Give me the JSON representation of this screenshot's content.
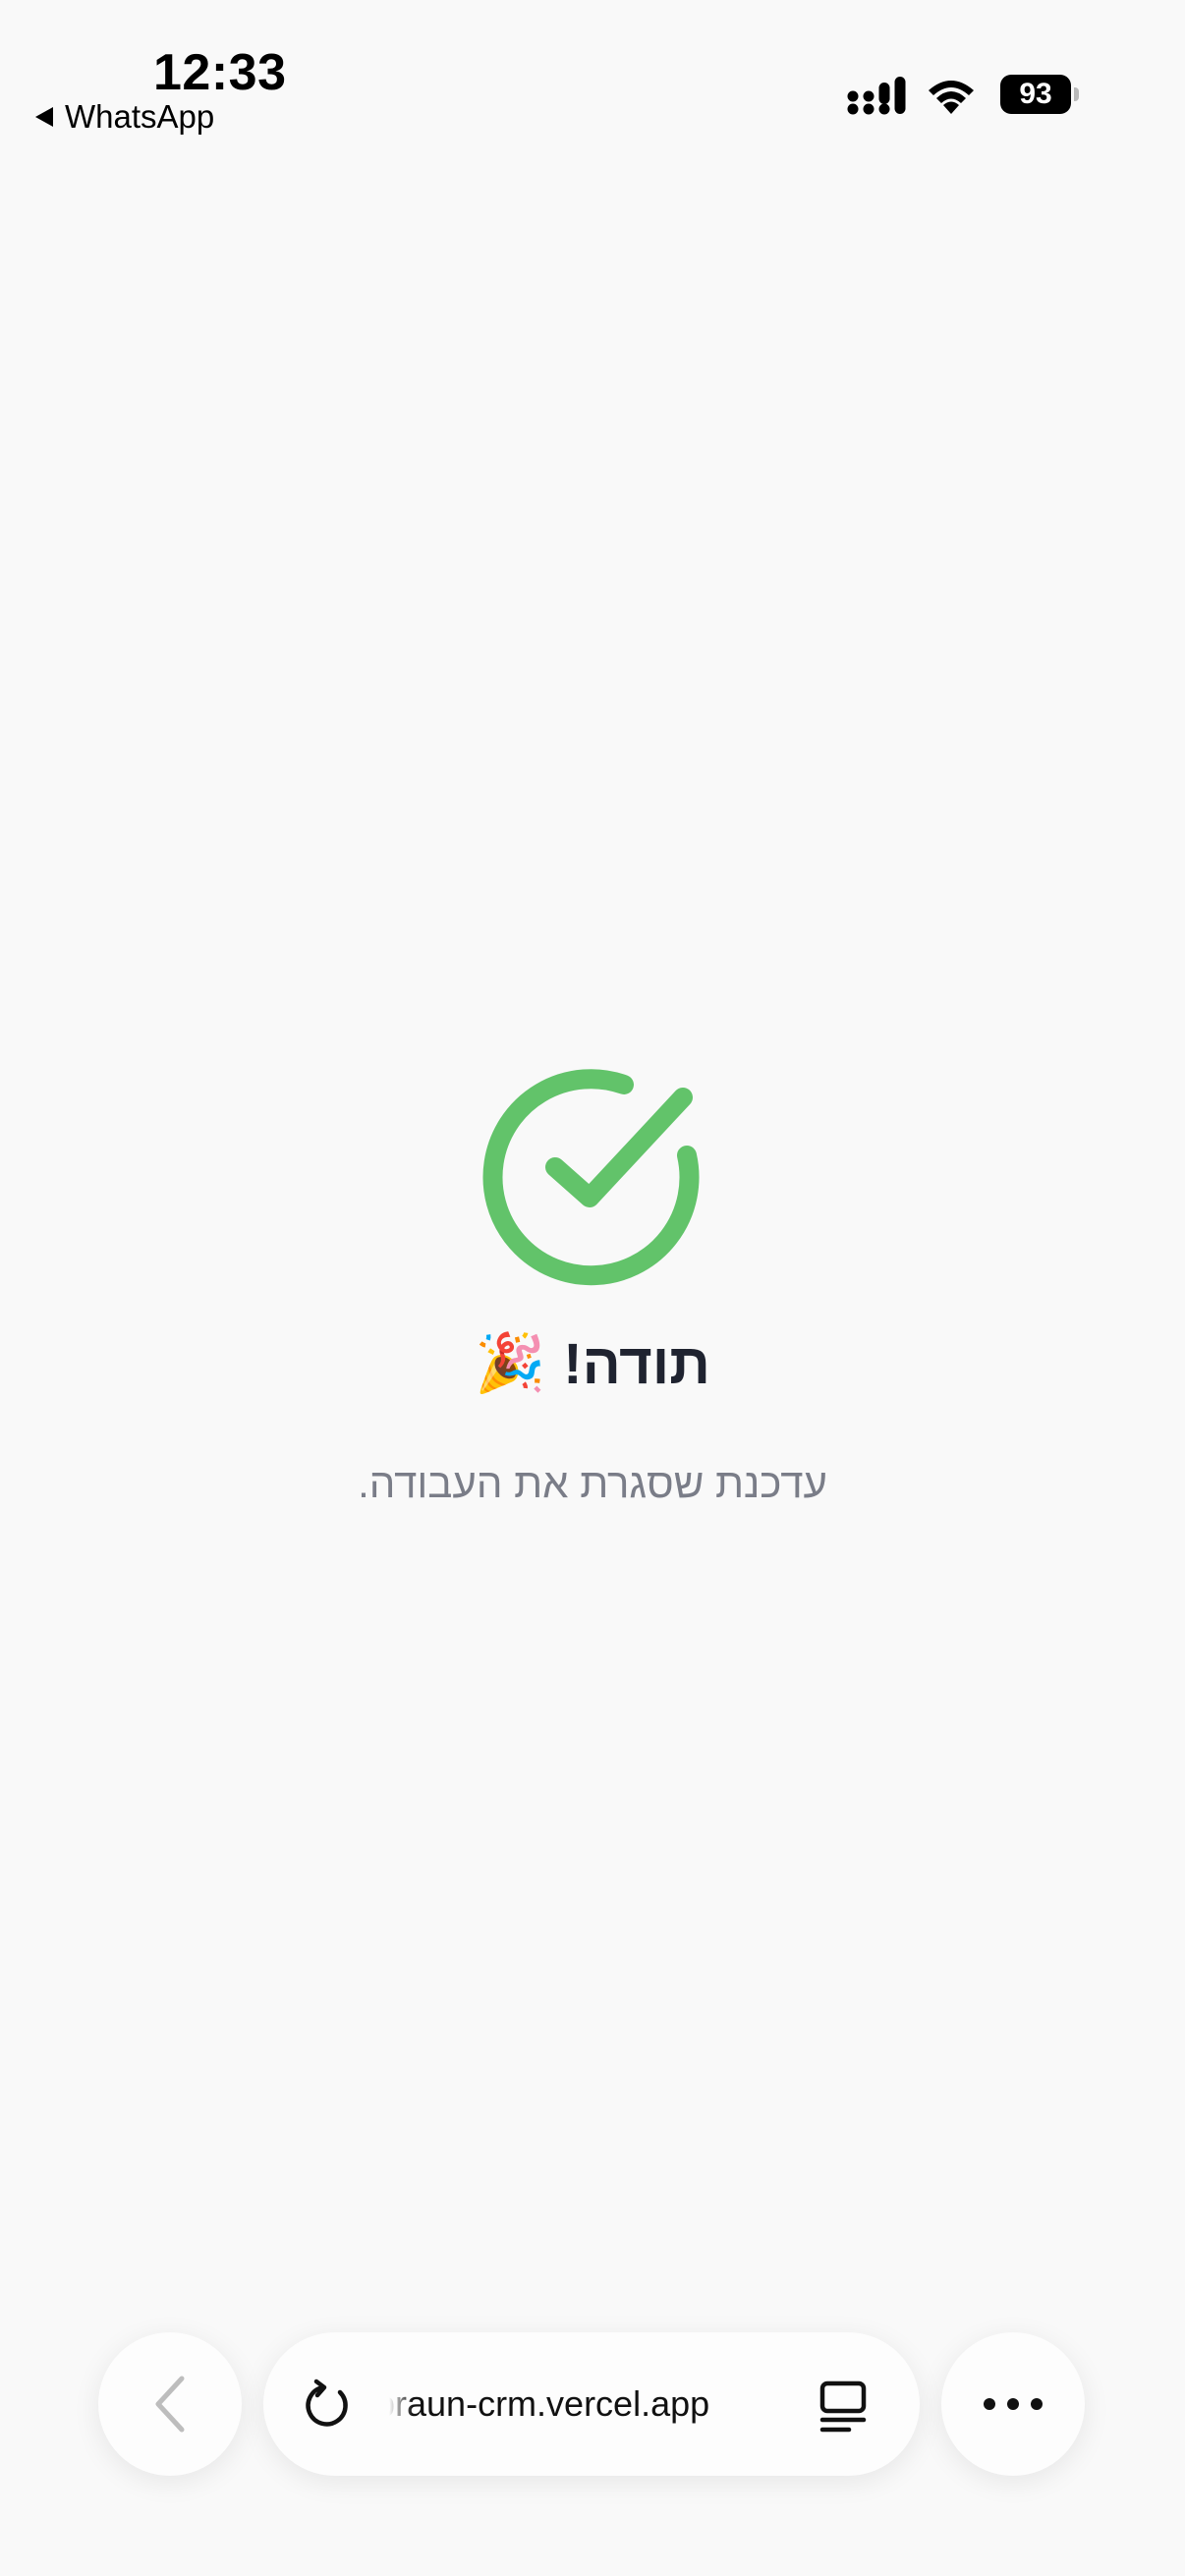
{
  "status_bar": {
    "time": "12:33",
    "back_app_label": "WhatsApp",
    "battery_level": "93"
  },
  "content": {
    "icon": "check-circle-icon",
    "title": "תודה!",
    "title_emoji": "🎉",
    "subtitle": "עדכנת שסגרת את העבודה.",
    "accent_color": "#62c36a"
  },
  "browser_bar": {
    "url": "braun-crm.vercel.app",
    "back_icon": "chevron-left-icon",
    "reload_icon": "reload-icon",
    "reader_icon": "reader-mode-icon",
    "more_icon": "more-icon"
  }
}
